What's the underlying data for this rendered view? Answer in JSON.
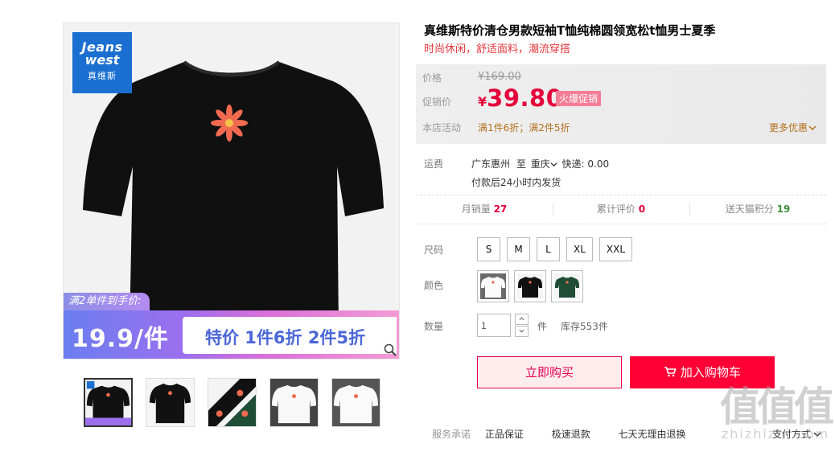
{
  "gallery": {
    "brand_en_1": "Jeans",
    "brand_en_2": "west",
    "brand_cn": "真维斯",
    "banner_top": "满2单件到手价:",
    "banner_price": "19.9/件",
    "banner_text": "特价 1件6折 2件5折",
    "thumbnails": [
      "black-tshirt",
      "black-tshirt-back",
      "flower-detail",
      "white-tshirt",
      "white-tshirt-2"
    ]
  },
  "product": {
    "title": "真维斯特价清仓男款短袖T恤纯棉圆领宽松t恤男士夏季",
    "subtitle": "时尚休闲，舒适面料，潮流穿搭"
  },
  "price": {
    "label_price": "价格",
    "original": "¥169.00",
    "label_promo": "促销价",
    "currency": "¥",
    "promo": "39.80",
    "hot_badge": "火爆促销",
    "label_activity": "本店活动",
    "activity": "满1件6折；满2件5折",
    "more": "更多优惠"
  },
  "shipping": {
    "label": "运费",
    "from": "广东惠州",
    "to_word": "至",
    "dest": "重庆",
    "express": "快递: 0.00",
    "dispatch": "付款后24小时内发货"
  },
  "stats": {
    "monthly_label": "月销量",
    "monthly_value": "27",
    "reviews_label": "累计评价",
    "reviews_value": "0",
    "points_label": "送天猫积分",
    "points_value": "19"
  },
  "options": {
    "size_label": "尺码",
    "sizes": [
      "S",
      "M",
      "L",
      "XL",
      "XXL"
    ],
    "color_label": "颜色",
    "qty_label": "数量",
    "qty_value": "1",
    "qty_unit": "件",
    "stock": "库存553件"
  },
  "actions": {
    "buy": "立即购买",
    "cart": "加入购物车"
  },
  "services": {
    "label": "服务承诺",
    "items": [
      "正品保证",
      "极速退款",
      "七天无理由退换"
    ],
    "pay": "支付方式"
  },
  "watermark": {
    "big": "值值值",
    "small": "zhizhizhi.com"
  },
  "colors": {
    "accent": "#ff0036",
    "promo_red": "#e4003a",
    "activity_brown": "#b3711d"
  }
}
